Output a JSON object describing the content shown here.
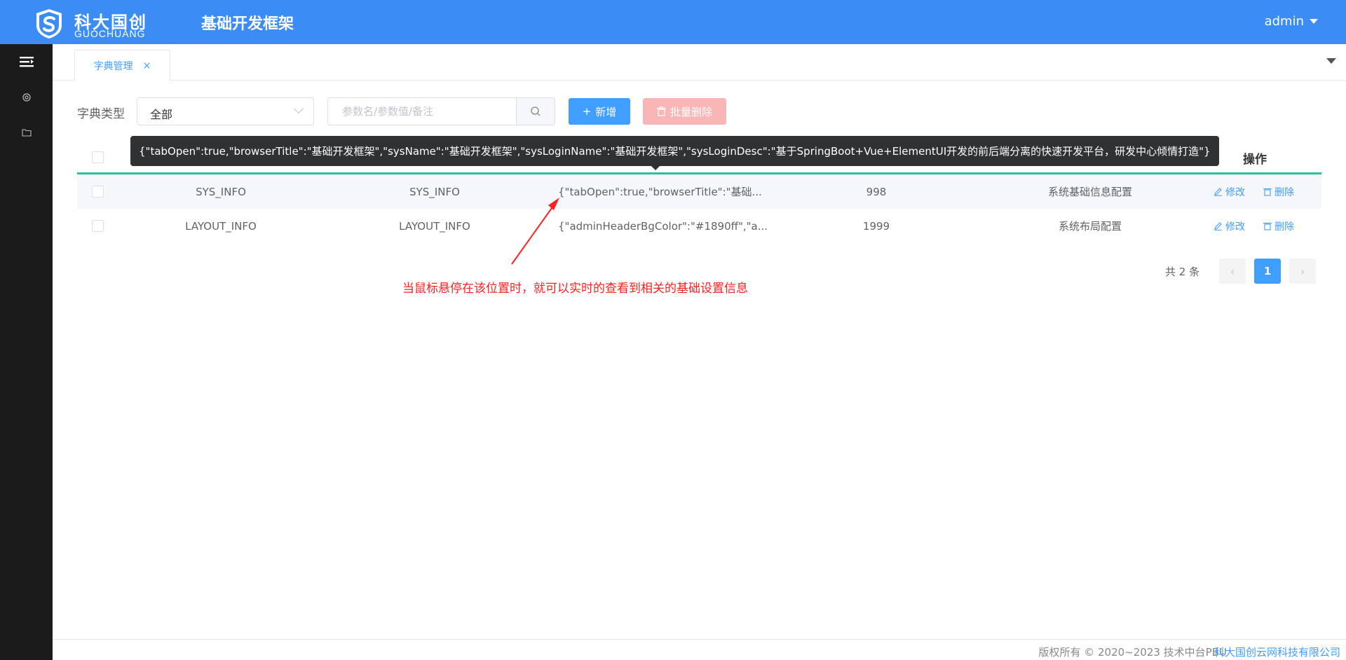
{
  "header": {
    "logo_cn": "科大国创",
    "logo_en": "GUOCHUANG",
    "system_title": "基础开发框架",
    "username": "admin"
  },
  "sidebar": {
    "items": [
      {
        "icon": "menu-toggle-icon"
      },
      {
        "icon": "settings-icon"
      },
      {
        "icon": "folder-icon"
      }
    ]
  },
  "tabs": [
    {
      "label": "字典管理",
      "close": "×",
      "active": true
    }
  ],
  "toolbar": {
    "dict_type_label": "字典类型",
    "dict_type_value": "全部",
    "search_placeholder": "参数名/参数值/备注",
    "add_label": "新增",
    "add_prefix": "+",
    "batch_delete_label": "批量删除"
  },
  "table": {
    "ops_header": "操作",
    "edit_label": "修改",
    "delete_label": "删除",
    "rows": [
      {
        "c1": "SYS_INFO",
        "c2": "SYS_INFO",
        "c3": "{\"tabOpen\":true,\"browserTitle\":\"基础...",
        "c4": "998",
        "c5": "系统基础信息配置"
      },
      {
        "c1": "LAYOUT_INFO",
        "c2": "LAYOUT_INFO",
        "c3": "{\"adminHeaderBgColor\":\"#1890ff\",\"a...",
        "c4": "1999",
        "c5": "系统布局配置"
      }
    ]
  },
  "tooltip": {
    "text": "{\"tabOpen\":true,\"browserTitle\":\"基础开发框架\",\"sysName\":\"基础开发框架\",\"sysLoginName\":\"基础开发框架\",\"sysLoginDesc\":\"基于SpringBoot+Vue+ElementUI开发的前后端分离的快速开发平台，研发中心倾情打造\"}"
  },
  "annotation": {
    "text": "当鼠标悬停在该位置时，就可以实时的查看到相关的基础设置信息",
    "color": "#ff2020"
  },
  "pagination": {
    "total": "共 2 条",
    "current_page": "1",
    "prev": "‹",
    "next": "›"
  },
  "footer": {
    "copyright": "版权所有 © 2020~2023 技术中台PBU",
    "company": "科大国创云网科技有限公司"
  },
  "colors": {
    "header_bg": "#3c8cf5",
    "sidebar_bg": "#1b1b1b",
    "primary": "#409eff",
    "danger_disabled": "#fab6b6",
    "table_header_border": "#2bbf9a"
  }
}
